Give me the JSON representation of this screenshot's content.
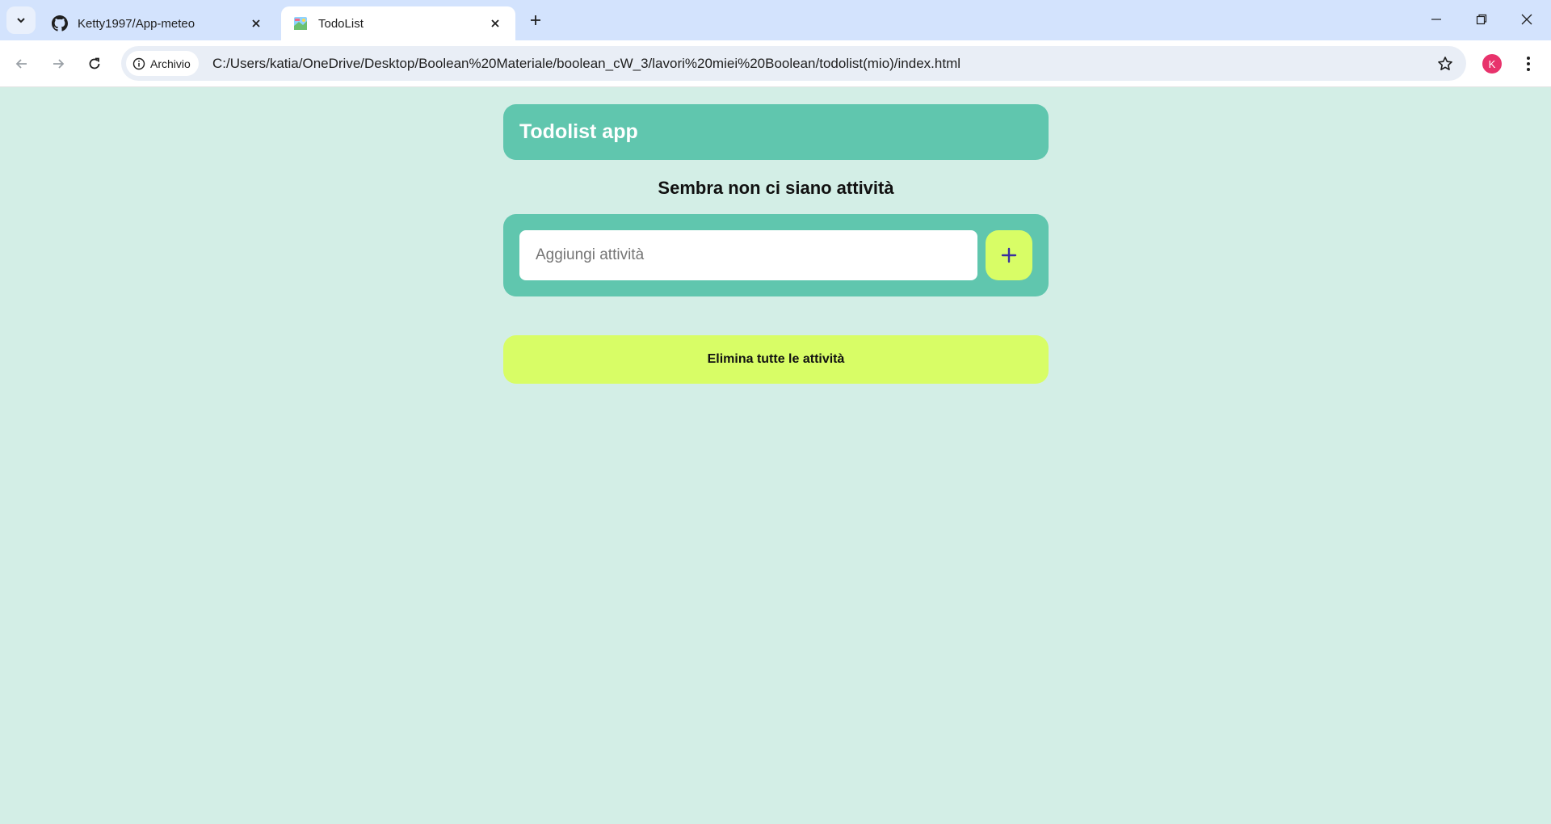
{
  "browser": {
    "tabs": [
      {
        "title": "Ketty1997/App-meteo",
        "icon": "github-icon",
        "active": false
      },
      {
        "title": "TodoList",
        "icon": "todolist-favicon",
        "active": true
      }
    ],
    "security_chip": "Archivio",
    "url": "C:/Users/katia/OneDrive/Desktop/Boolean%20Materiale/boolean_cW_3/lavori%20miei%20Boolean/todolist(mio)/index.html",
    "profile_initial": "K",
    "profile_color": "#e8336c"
  },
  "app": {
    "title": "Todolist app",
    "empty_message": "Sembra non ci siano attività",
    "input_placeholder": "Aggiungi attività",
    "add_icon": "plus-icon",
    "clear_button": "Elimina tutte le attività"
  },
  "colors": {
    "page_background": "#d3eee6",
    "primary": "#60c6ae",
    "accent": "#d8fd66",
    "plus_icon": "#3a2fa0"
  }
}
